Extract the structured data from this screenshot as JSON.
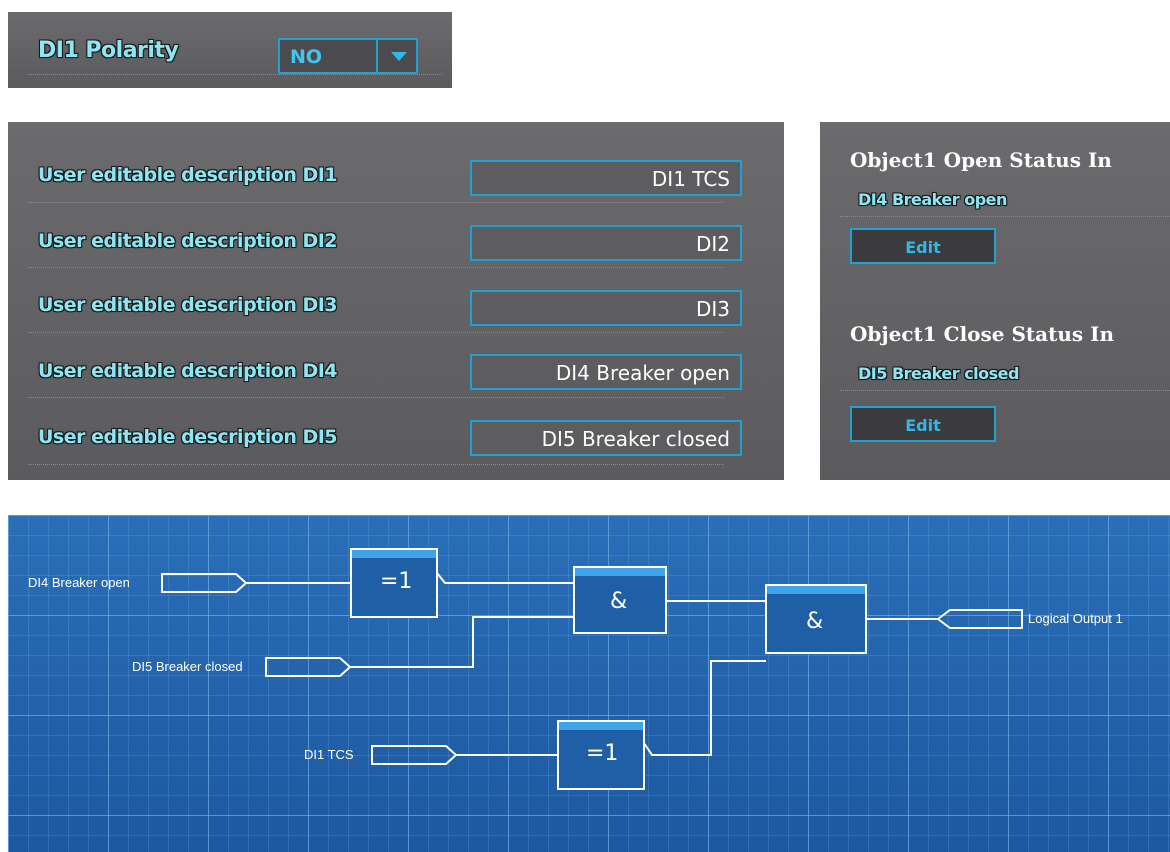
{
  "polarity": {
    "label": "DI1 Polarity",
    "value": "NO"
  },
  "descriptions": [
    {
      "label": "User editable description DI1",
      "value": "DI1  TCS"
    },
    {
      "label": "User editable description DI2",
      "value": "DI2"
    },
    {
      "label": "User editable description DI3",
      "value": "DI3"
    },
    {
      "label": "User editable description DI4",
      "value": "DI4 Breaker open"
    },
    {
      "label": "User editable description DI5",
      "value": "DI5 Breaker closed"
    }
  ],
  "object_status": {
    "open": {
      "title": "Object1 Open Status In",
      "value": "DI4 Breaker open",
      "button": "Edit"
    },
    "close": {
      "title": "Object1 Close Status In",
      "value": "DI5 Breaker closed",
      "button": "Edit"
    }
  },
  "logic": {
    "inputs": {
      "di4": "DI4 Breaker open",
      "di5": "DI5 Breaker closed",
      "di1": "DI1 TCS"
    },
    "gates": {
      "xor1": "=1",
      "and1": "&",
      "and2": "&",
      "xor2": "=1"
    },
    "output": "Logical Output 1"
  },
  "colors": {
    "accent": "#1ea2d4",
    "label_glow": "#8fe6f3",
    "panel": "#606063",
    "grid_bg": "#1f5fa6"
  },
  "icons": {
    "dropdown": "chevron-down-icon"
  }
}
